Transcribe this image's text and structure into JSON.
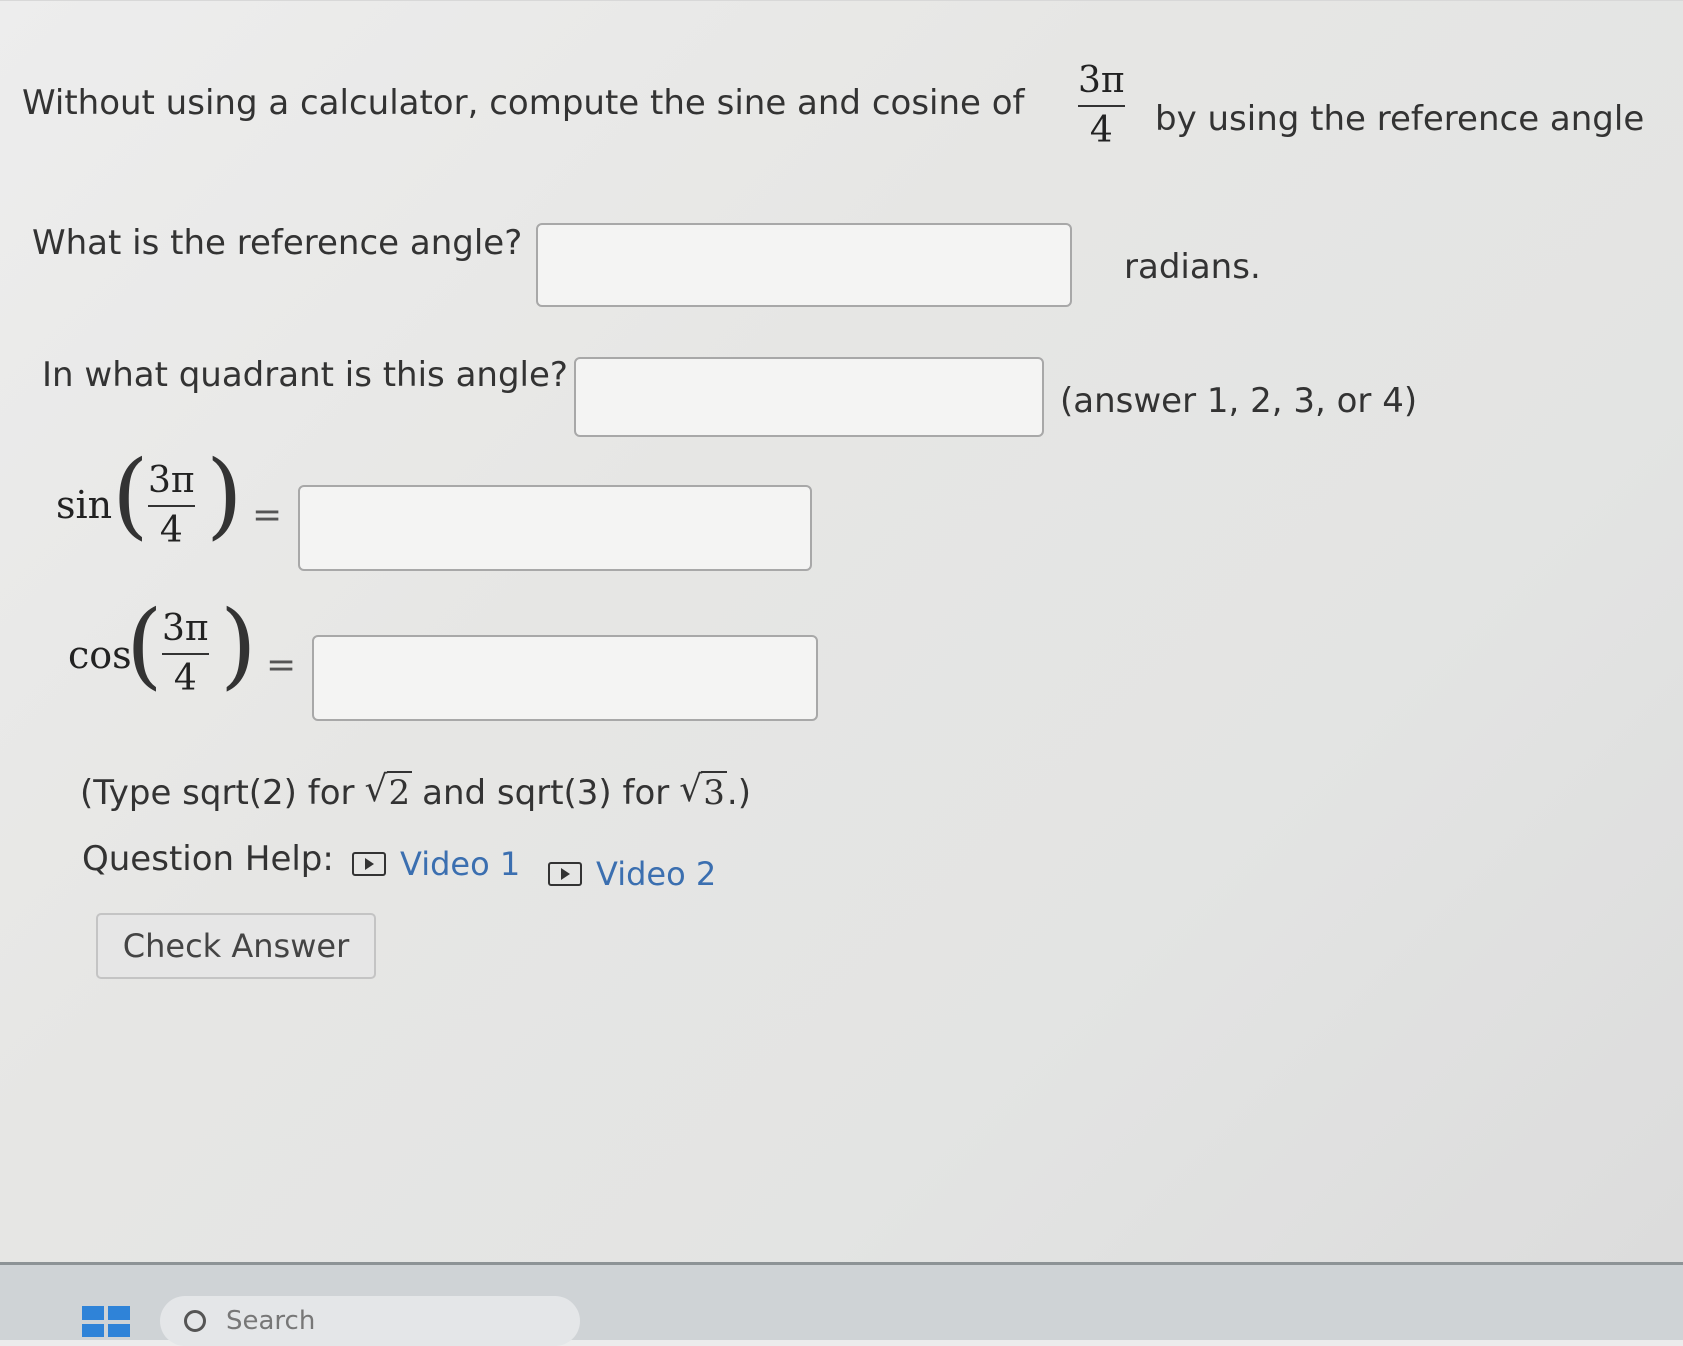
{
  "question": {
    "intro_before": "Without using a calculator, compute the sine and cosine of",
    "intro_after": "by using the reference angle",
    "angle_num": "3π",
    "angle_den": "4",
    "ref_angle_label": "What is the reference angle?",
    "ref_angle_unit": "radians.",
    "ref_angle_value": "",
    "quadrant_label": "In what quadrant is this angle?",
    "quadrant_hint": "(answer 1, 2, 3, or 4)",
    "quadrant_value": "",
    "sin_label": "sin",
    "cos_label": "cos",
    "equals": "=",
    "sin_value": "",
    "cos_value": "",
    "hint_type": "(Type sqrt(2) for",
    "hint_and": "and sqrt(3) for",
    "hint_end": ".)",
    "sqrt2_arg": "2",
    "sqrt3_arg": "3",
    "radical": "√"
  },
  "help": {
    "label": "Question Help:",
    "video1": "Video 1",
    "video2": "Video 2",
    "video_icon": "play-video-icon"
  },
  "check_answer": "Check Answer",
  "taskbar": {
    "search_placeholder": "Search",
    "start_icon": "windows-start-icon",
    "search_icon": "search-icon"
  },
  "colors": {
    "link": "#3b6fb0",
    "windows_blue": "#2f83d8"
  }
}
